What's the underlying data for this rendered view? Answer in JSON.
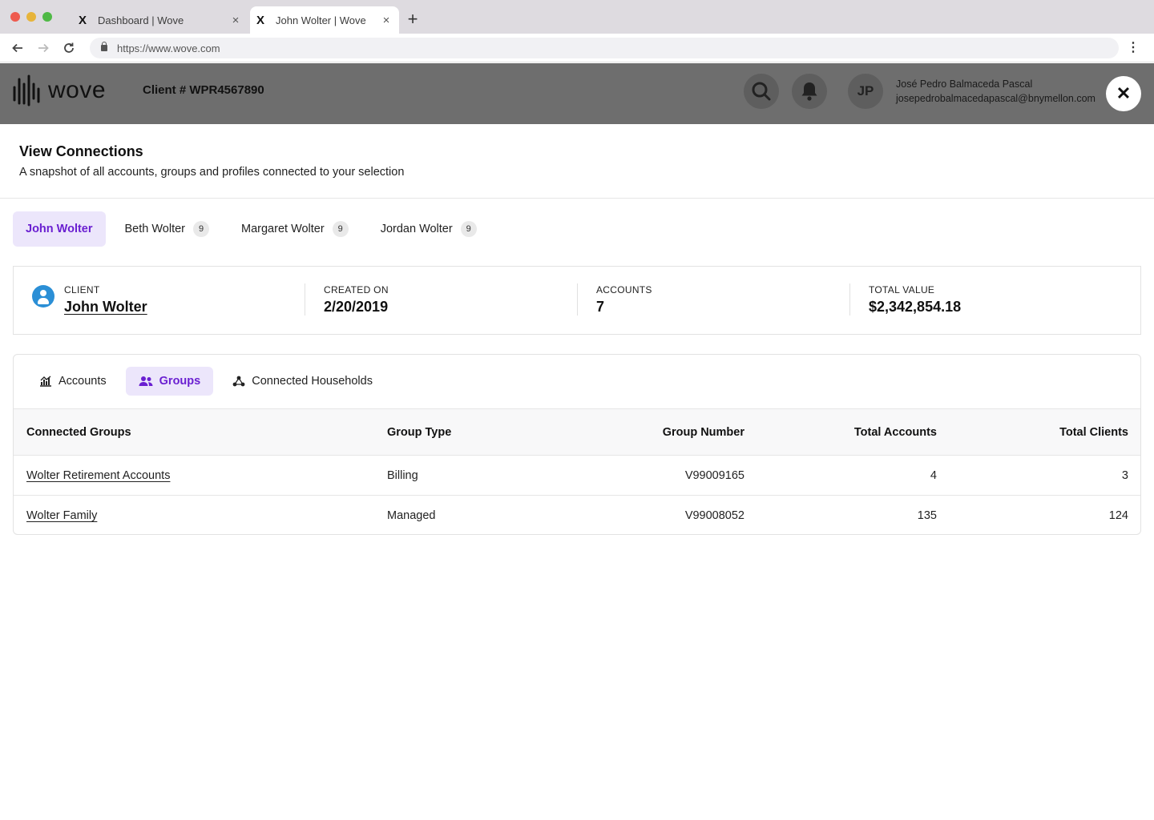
{
  "browser": {
    "tabs": [
      {
        "label": "Dashboard | Wove",
        "favicon": "X",
        "active": false
      },
      {
        "label": "John Wolter | Wove",
        "favicon": "X",
        "active": true
      }
    ],
    "url": "https://www.wove.com"
  },
  "app_header": {
    "logo_text": "wove",
    "client_number": "Client # WPR4567890",
    "avatar_initials": "JP",
    "user_name": "José Pedro Balmaceda Pascal",
    "user_email": "josepedrobalmacedapascal@bnymellon.com"
  },
  "modal": {
    "title": "View Connections",
    "subtitle": "A snapshot of all accounts, groups and profiles connected to your selection",
    "close_symbol": "✕"
  },
  "person_tabs": [
    {
      "label": "John Wolter",
      "count": null,
      "active": true
    },
    {
      "label": "Beth Wolter",
      "count": "9",
      "active": false
    },
    {
      "label": "Margaret Wolter",
      "count": "9",
      "active": false
    },
    {
      "label": "Jordan Wolter",
      "count": "9",
      "active": false
    }
  ],
  "summary": {
    "client_label": "CLIENT",
    "client_value": "John Wolter",
    "created_label": "CREATED ON",
    "created_value": "2/20/2019",
    "accounts_label": "ACCOUNTS",
    "accounts_value": "7",
    "total_label": "TOTAL VALUE",
    "total_value": "$2,342,854.18"
  },
  "view_tabs": [
    {
      "label": "Accounts",
      "icon": "chart-icon",
      "active": false
    },
    {
      "label": "Groups",
      "icon": "users-icon",
      "active": true
    },
    {
      "label": "Connected Households",
      "icon": "households-icon",
      "active": false
    }
  ],
  "table": {
    "headers": [
      "Connected Groups",
      "Group Type",
      "Group Number",
      "Total Accounts",
      "Total Clients"
    ],
    "rows": [
      [
        "Wolter Retirement Accounts",
        "Billing",
        "V99009165",
        "4",
        "3"
      ],
      [
        "Wolter Family",
        "Managed",
        "V99008052",
        "135",
        "124"
      ]
    ]
  },
  "colors": {
    "accent": "#6a1fd1",
    "accent_bg": "#ece6fb",
    "client_icon": "#2b8fd6",
    "overlay_header": "#6e6e6e"
  }
}
